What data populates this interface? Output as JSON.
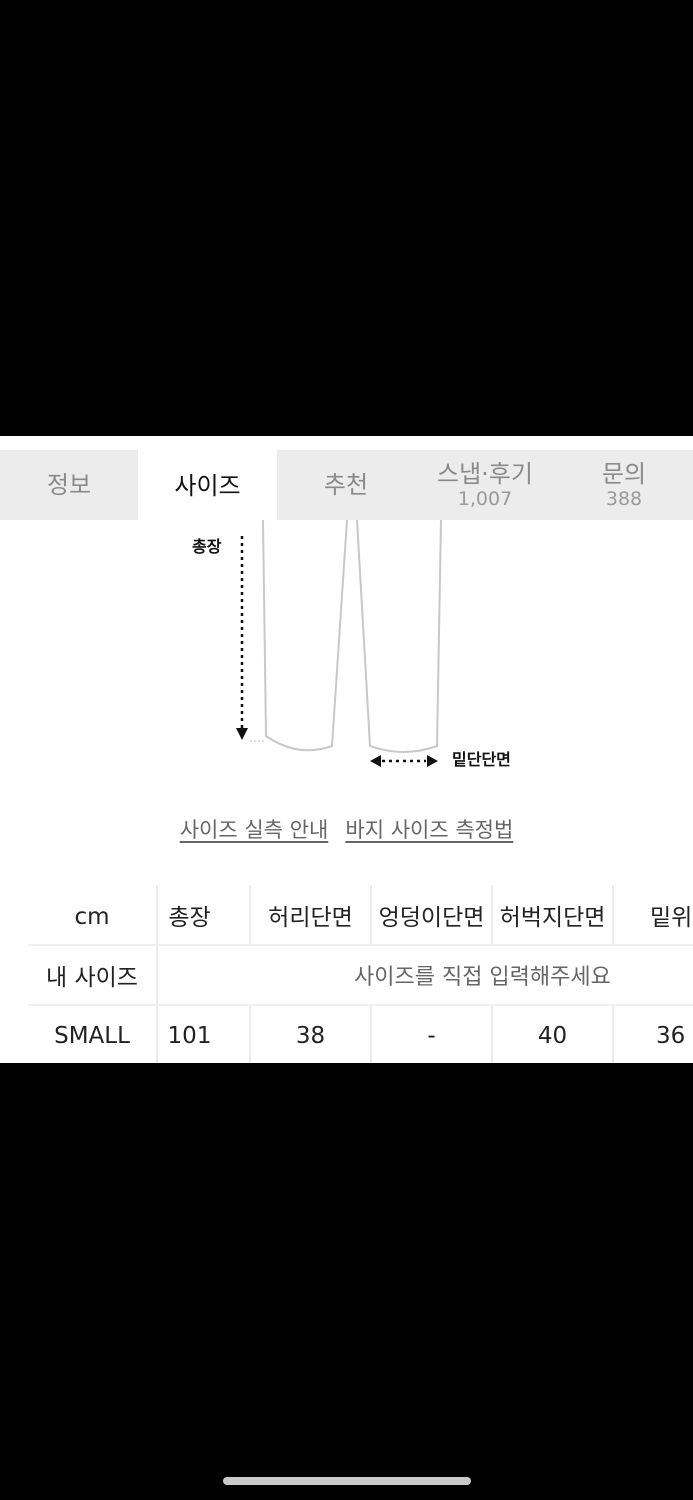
{
  "tabs": [
    {
      "label": "정보",
      "count": ""
    },
    {
      "label": "사이즈",
      "count": ""
    },
    {
      "label": "추천",
      "count": ""
    },
    {
      "label": "스냅·후기",
      "count": "1,007"
    },
    {
      "label": "문의",
      "count": "388"
    }
  ],
  "diagram": {
    "length_label": "총장",
    "hem_label": "밑단단면"
  },
  "links": {
    "size_guide": "사이즈 실측 안내",
    "pants_measure": "바지 사이즈 측정법"
  },
  "size_table": {
    "headers": [
      "cm",
      "총장",
      "허리단면",
      "엉덩이단면",
      "허벅지단면",
      "밑위"
    ],
    "my_size_label": "내 사이즈",
    "my_size_placeholder": "사이즈를 직접 입력해주세요",
    "rows": [
      {
        "size": "SMALL",
        "values": [
          "101",
          "38",
          "-",
          "40",
          "36"
        ]
      }
    ]
  }
}
